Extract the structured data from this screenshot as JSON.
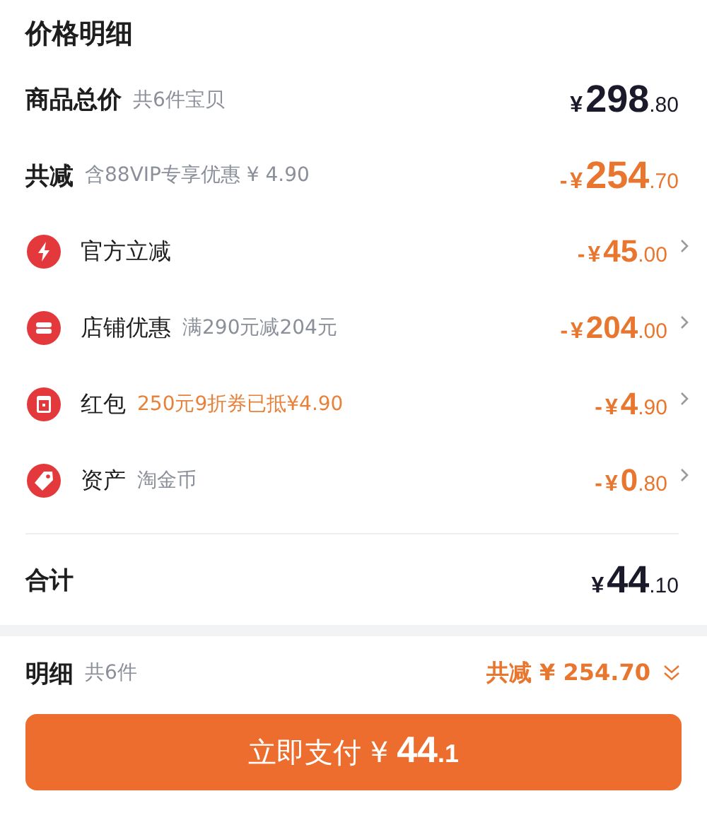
{
  "title": "价格明细",
  "summary": [
    {
      "label": "商品总价",
      "note": "共6件宝贝",
      "kind": "total",
      "price": {
        "currency": "¥",
        "main": "298",
        "cents": ".80"
      }
    },
    {
      "label": "共减",
      "note": "含88VIP专享优惠 ¥ 4.90",
      "kind": "discount",
      "price": {
        "sign": "-",
        "currency": "¥",
        "main": "254",
        "cents": ".70"
      }
    }
  ],
  "discounts": [
    {
      "kind": "bolt",
      "label": "官方立减",
      "price": {
        "sign": "-",
        "currency": "¥",
        "main": "45",
        "cents": ".00"
      }
    },
    {
      "kind": "shop",
      "label": "店铺优惠",
      "note": "满290元减204元",
      "note_accent": false,
      "price": {
        "sign": "-",
        "currency": "¥",
        "main": "204",
        "cents": ".00"
      }
    },
    {
      "kind": "packet",
      "label": "红包",
      "note": "250元9折券已抵¥4.90",
      "note_accent": true,
      "price": {
        "sign": "-",
        "currency": "¥",
        "main": "4",
        "cents": ".90"
      }
    },
    {
      "kind": "tag",
      "label": "资产",
      "note": "淘金币",
      "note_accent": false,
      "price": {
        "sign": "-",
        "currency": "¥",
        "main": "0",
        "cents": ".80"
      }
    }
  ],
  "sum": {
    "label": "合计",
    "price": {
      "currency": "¥",
      "main": "44",
      "cents": ".10"
    }
  },
  "footer": {
    "label": "明细",
    "count": "共6件",
    "saving": "共减 ¥ 254.70",
    "expanded": false
  },
  "pay_button": {
    "label": "立即支付 ¥",
    "main": "44",
    "cents": ".1"
  }
}
